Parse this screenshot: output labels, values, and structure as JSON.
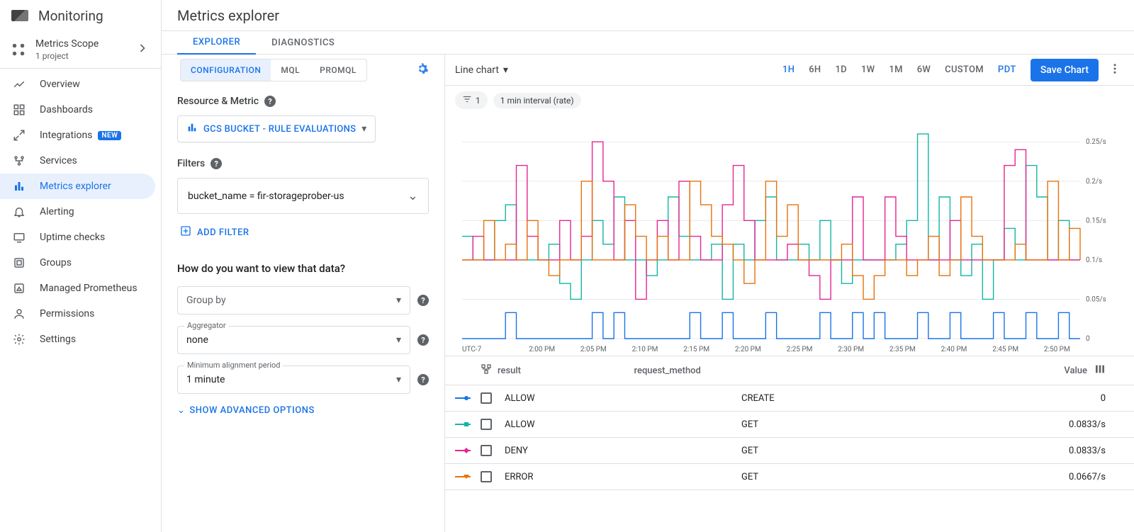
{
  "sidebar": {
    "brand": "Monitoring",
    "scope_title": "Metrics Scope",
    "scope_subtitle": "1 project",
    "items": [
      {
        "icon": "overview-icon",
        "label": "Overview"
      },
      {
        "icon": "dashboards-icon",
        "label": "Dashboards"
      },
      {
        "icon": "integrations-icon",
        "label": "Integrations",
        "badge": "NEW"
      },
      {
        "icon": "services-icon",
        "label": "Services"
      },
      {
        "icon": "metrics-icon",
        "label": "Metrics explorer",
        "active": true
      },
      {
        "icon": "alerting-icon",
        "label": "Alerting"
      },
      {
        "icon": "uptime-icon",
        "label": "Uptime checks"
      },
      {
        "icon": "groups-icon",
        "label": "Groups"
      },
      {
        "icon": "prometheus-icon",
        "label": "Managed Prometheus"
      },
      {
        "icon": "permissions-icon",
        "label": "Permissions"
      },
      {
        "icon": "settings-icon",
        "label": "Settings"
      }
    ]
  },
  "header": {
    "title": "Metrics explorer"
  },
  "tabs": {
    "items": [
      "EXPLORER",
      "DIAGNOSTICS"
    ],
    "active": 0
  },
  "subtabs": {
    "items": [
      "CONFIGURATION",
      "MQL",
      "PROMQL"
    ],
    "active": 0
  },
  "config": {
    "resource_label": "Resource & Metric",
    "metric_chip": "GCS BUCKET - RULE EVALUATIONS",
    "filters_label": "Filters",
    "filter_text": "bucket_name = fir-storageprober-us",
    "add_filter_label": "ADD FILTER",
    "view_heading": "How do you want to view that data?",
    "groupby_placeholder": "Group by",
    "aggregator_label": "Aggregator",
    "aggregator_value": "none",
    "align_label": "Minimum alignment period",
    "align_value": "1 minute",
    "advanced_label": "SHOW ADVANCED OPTIONS"
  },
  "toolbar": {
    "chart_type": "Line chart",
    "ranges": [
      "1H",
      "6H",
      "1D",
      "1W",
      "1M",
      "6W",
      "CUSTOM"
    ],
    "range_active": 0,
    "tz": "PDT",
    "save_label": "Save Chart"
  },
  "chips": {
    "filter_count": "1",
    "interval": "1 min interval (rate)"
  },
  "chart_data": {
    "type": "line",
    "ylim": [
      0,
      0.27
    ],
    "y_ticks": [
      "0.25/s",
      "0.2/s",
      "0.15/s",
      "0.1/s",
      "0.05/s",
      "0"
    ],
    "x_left_label": "UTC-7",
    "x_ticks": [
      "2:00 PM",
      "2:05 PM",
      "2:10 PM",
      "2:15 PM",
      "2:20 PM",
      "2:25 PM",
      "2:30 PM",
      "2:35 PM",
      "2:40 PM",
      "2:45 PM",
      "2:50 PM"
    ],
    "series": [
      {
        "name": "ALLOW-CREATE",
        "color": "#1a73e8",
        "marker": "circle",
        "values": [
          0,
          0,
          0,
          0,
          0.033,
          0,
          0,
          0,
          0,
          0,
          0,
          0,
          0.033,
          0,
          0.033,
          0,
          0,
          0,
          0,
          0,
          0,
          0.033,
          0,
          0,
          0.033,
          0,
          0,
          0,
          0.033,
          0,
          0,
          0,
          0,
          0.033,
          0,
          0,
          0.033,
          0,
          0.033,
          0,
          0,
          0,
          0.033,
          0,
          0,
          0.033,
          0,
          0,
          0,
          0.033,
          0,
          0,
          0.033,
          0,
          0,
          0.033,
          0,
          0
        ]
      },
      {
        "name": "ALLOW-GET",
        "color": "#12b5a5",
        "marker": "square",
        "values": [
          0.13,
          0.1,
          0.1,
          0.15,
          0.17,
          0.1,
          0.1,
          0.1,
          0.12,
          0.07,
          0.05,
          0.1,
          0.15,
          0.12,
          0.18,
          0.1,
          0.1,
          0.08,
          0.1,
          0.18,
          0.13,
          0.1,
          0.1,
          0.12,
          0.05,
          0.12,
          0.1,
          0.15,
          0.18,
          0.1,
          0.1,
          0.12,
          0.1,
          0.15,
          0.1,
          0.07,
          0.1,
          0.1,
          0.1,
          0.1,
          0.12,
          0.15,
          0.26,
          0.1,
          0.18,
          0.1,
          0.08,
          0.12,
          0.05,
          0.1,
          0.14,
          0.1,
          0.22,
          0.18,
          0.1,
          0.15,
          0.1,
          0.1
        ]
      },
      {
        "name": "DENY-GET",
        "color": "#e52592",
        "marker": "diamond",
        "values": [
          0.1,
          0.13,
          0.1,
          0.1,
          0.1,
          0.22,
          0.13,
          0.1,
          0.1,
          0.15,
          0.1,
          0.13,
          0.25,
          0.2,
          0.1,
          0.15,
          0.05,
          0.1,
          0.15,
          0.1,
          0.2,
          0.13,
          0.1,
          0.1,
          0.17,
          0.22,
          0.15,
          0.1,
          0.1,
          0.1,
          0.12,
          0.1,
          0.08,
          0.05,
          0.1,
          0.1,
          0.18,
          0.1,
          0.1,
          0.18,
          0.13,
          0.1,
          0.1,
          0.1,
          0.1,
          0.15,
          0.1,
          0.1,
          0.1,
          0.1,
          0.22,
          0.24,
          0.1,
          0.1,
          0.1,
          0.1,
          0.1,
          0.1
        ]
      },
      {
        "name": "ERROR-GET",
        "color": "#e8710a",
        "marker": "triangle",
        "values": [
          0.1,
          0.1,
          0.15,
          0.1,
          0.12,
          0.1,
          0.15,
          0.1,
          0.08,
          0.1,
          0.1,
          0.2,
          0.1,
          0.1,
          0.1,
          0.17,
          0.13,
          0.1,
          0.13,
          0.1,
          0.1,
          0.2,
          0.17,
          0.13,
          0.12,
          0.1,
          0.07,
          0.1,
          0.2,
          0.13,
          0.17,
          0.1,
          0.1,
          0.1,
          0.1,
          0.12,
          0.08,
          0.05,
          0.08,
          0.1,
          0.1,
          0.08,
          0.1,
          0.13,
          0.08,
          0.1,
          0.18,
          0.13,
          0.1,
          0.1,
          0.1,
          0.12,
          0.1,
          0.1,
          0.2,
          0.1,
          0.14,
          0.1
        ]
      }
    ]
  },
  "legend": {
    "col_result": "result",
    "col_request": "request_method",
    "col_value": "Value",
    "rows": [
      {
        "color": "#1a73e8",
        "marker": "circle",
        "result": "ALLOW",
        "request": "CREATE",
        "value": "0"
      },
      {
        "color": "#12b5a5",
        "marker": "square",
        "result": "ALLOW",
        "request": "GET",
        "value": "0.0833/s"
      },
      {
        "color": "#e52592",
        "marker": "diamond",
        "result": "DENY",
        "request": "GET",
        "value": "0.0833/s"
      },
      {
        "color": "#e8710a",
        "marker": "triangle",
        "result": "ERROR",
        "request": "GET",
        "value": "0.0667/s"
      }
    ]
  }
}
